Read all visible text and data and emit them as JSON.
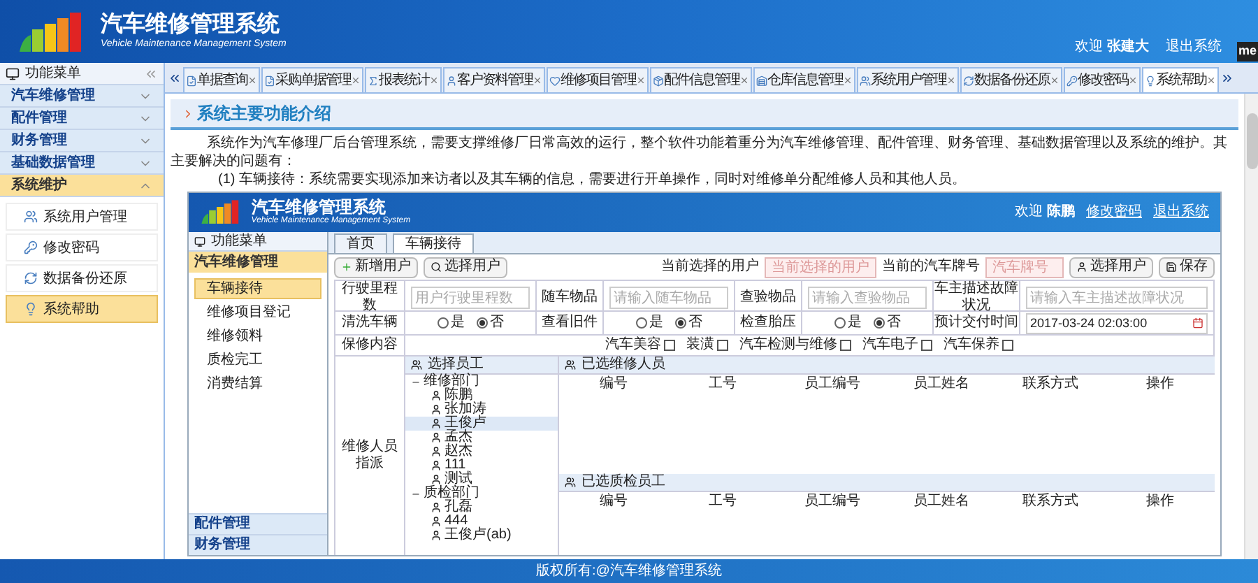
{
  "header": {
    "title": "汽车维修管理系统",
    "subtitle": "Vehicle Maintenance Management System",
    "welcome": "欢迎",
    "user": "张建大",
    "logout": "退出系统",
    "edge_badge": "me"
  },
  "sidebar": {
    "title": "功能菜单",
    "groups": [
      {
        "label": "汽车维修管理",
        "expanded": false
      },
      {
        "label": "配件管理",
        "expanded": false
      },
      {
        "label": "财务管理",
        "expanded": false
      },
      {
        "label": "基础数据管理",
        "expanded": false
      },
      {
        "label": "系统维护",
        "expanded": true,
        "items": [
          {
            "label": "系统用户管理",
            "selected": false
          },
          {
            "label": "修改密码",
            "selected": false
          },
          {
            "label": "数据备份还原",
            "selected": false
          },
          {
            "label": "系统帮助",
            "selected": true
          }
        ]
      }
    ]
  },
  "tabs": [
    {
      "label": "单据查询",
      "selected": false
    },
    {
      "label": "采购单据管理",
      "selected": false
    },
    {
      "label": "报表统计",
      "selected": false
    },
    {
      "label": "客户资料管理",
      "selected": false
    },
    {
      "label": "维修项目管理",
      "selected": false
    },
    {
      "label": "配件信息管理",
      "selected": false
    },
    {
      "label": "仓库信息管理",
      "selected": false
    },
    {
      "label": "系统用户管理",
      "selected": false
    },
    {
      "label": "数据备份还原",
      "selected": false
    },
    {
      "label": "修改密码",
      "selected": false
    },
    {
      "label": "系统帮助",
      "selected": true
    }
  ],
  "content": {
    "heading": "系统主要功能介绍",
    "intro": "系统作为汽车修理厂后台管理系统，需要支撑维修厂日常高效的运行，整个软件功能着重分为汽车维修管理、配件管理、财务管理、基础数据管理以及系统的维护。其主要解决的问题有：",
    "point": "(1) 车辆接待：系统需要实现添加来访者以及其车辆的信息，需要进行开单操作，同时对维修单分配维修人员和其他人员。",
    "screenshot": {
      "header": {
        "title": "汽车维修管理系统",
        "subtitle": "Vehicle Maintenance Management System",
        "welcome": "欢迎",
        "user": "陈鹏",
        "links": [
          "修改密码",
          "退出系统"
        ]
      },
      "sidebar": {
        "title": "功能菜单",
        "group": "汽车维修管理",
        "items": [
          {
            "label": "车辆接待",
            "selected": true
          },
          {
            "label": "维修项目登记",
            "selected": false
          },
          {
            "label": "维修领料",
            "selected": false
          },
          {
            "label": "质检完工",
            "selected": false
          },
          {
            "label": "消费结算",
            "selected": false
          }
        ],
        "other_groups": [
          "配件管理",
          "财务管理"
        ]
      },
      "tabs": [
        {
          "label": "首页",
          "selected": false
        },
        {
          "label": "车辆接待",
          "selected": true
        }
      ],
      "toolbar": {
        "buttons": [
          "新增用户",
          "选择用户"
        ],
        "user_label": "当前选择的用户",
        "user_placeholder": "当前选择的用户",
        "plate_label": "当前的汽车牌号",
        "plate_placeholder": "汽车牌号",
        "right_buttons": [
          "选择用户",
          "保存"
        ]
      },
      "fields": [
        {
          "label": "行驶里程数",
          "placeholder": "用户行驶里程数"
        },
        {
          "label": "随车物品",
          "placeholder": "请输入随车物品"
        },
        {
          "label": "查验物品",
          "placeholder": "请输入查验物品"
        },
        {
          "label": "车主描述故障状况",
          "placeholder": "请输入车主描述故障状况"
        }
      ],
      "radio_rows": [
        {
          "label": "清洗车辆",
          "options": [
            {
              "label": "是",
              "selected": false
            },
            {
              "label": "否",
              "selected": true
            }
          ]
        },
        {
          "label": "查看旧件",
          "options": [
            {
              "label": "是",
              "selected": false
            },
            {
              "label": "否",
              "selected": true
            }
          ]
        },
        {
          "label": "检查胎压",
          "options": [
            {
              "label": "是",
              "selected": false
            },
            {
              "label": "否",
              "selected": true
            }
          ]
        }
      ],
      "delivery": {
        "label": "预计交付时间",
        "value": "2017-03-24 02:03:00"
      },
      "repair_content": {
        "label": "保修内容",
        "options": [
          {
            "label": "汽车美容",
            "checked": false
          },
          {
            "label": "装潢",
            "checked": false
          },
          {
            "label": "汽车检测与维修",
            "checked": false
          },
          {
            "label": "汽车电子",
            "checked": false
          },
          {
            "label": "汽车保养",
            "checked": false
          }
        ]
      },
      "assign_label": "维修人员指派",
      "tree": {
        "title": "选择员工",
        "nodes": [
          {
            "label": "维修部门",
            "expanded": true,
            "selected": false,
            "children": [
              {
                "label": "陈鹏",
                "selected": false
              },
              {
                "label": "张加涛",
                "selected": false
              },
              {
                "label": "王俊卢",
                "selected": true
              },
              {
                "label": "孟杰",
                "selected": false
              },
              {
                "label": "赵杰",
                "selected": false
              },
              {
                "label": "111",
                "selected": false
              },
              {
                "label": "测试",
                "selected": false
              }
            ]
          },
          {
            "label": "质检部门",
            "expanded": true,
            "selected": false,
            "children": [
              {
                "label": "孔磊",
                "selected": false
              },
              {
                "label": "444",
                "selected": false
              },
              {
                "label": "王俊卢(ab)",
                "selected": false
              }
            ]
          }
        ]
      },
      "tables": [
        {
          "title": "已选维修人员",
          "columns": [
            "编号",
            "工号",
            "员工编号",
            "员工姓名",
            "联系方式",
            "操作"
          ]
        },
        {
          "title": "已选质检员工",
          "columns": [
            "编号",
            "工号",
            "员工编号",
            "员工姓名",
            "联系方式",
            "操作"
          ]
        }
      ]
    }
  },
  "footer": "版权所有:@汽车维修管理系统"
}
